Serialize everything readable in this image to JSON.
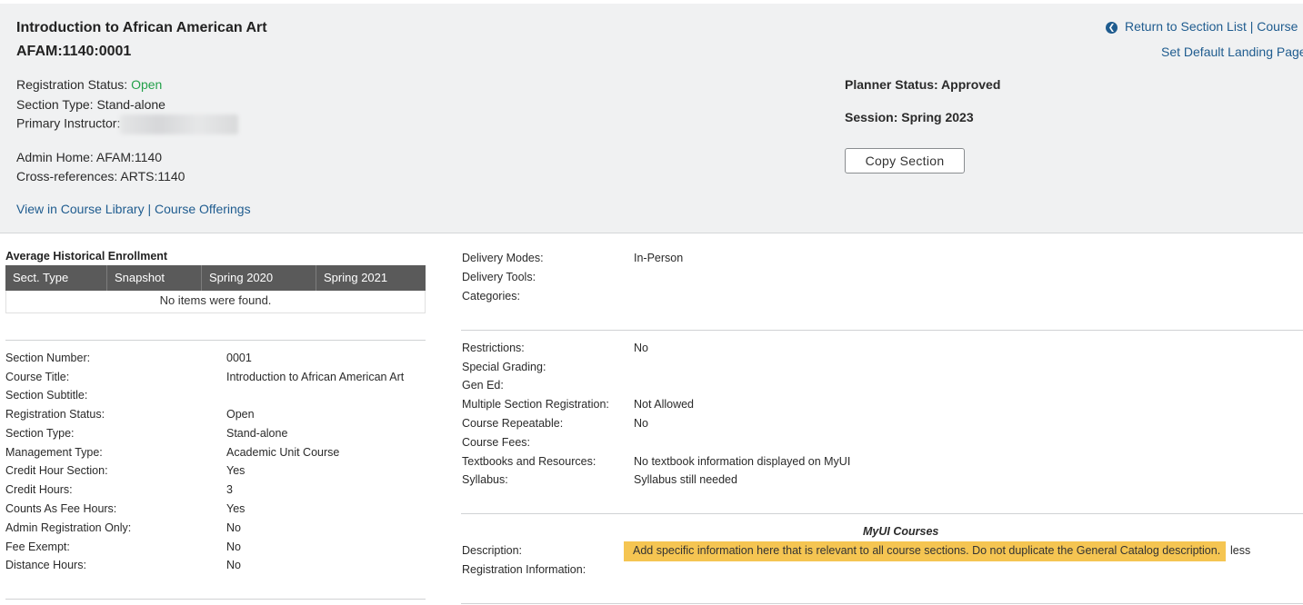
{
  "header": {
    "course_title": "Introduction to African American Art",
    "course_code": "AFAM:1140:0001",
    "registration_status_label": "Registration Status:",
    "registration_status_value": "Open",
    "section_type": "Section Type: Stand-alone",
    "primary_instructor_label": "Primary Instructor:",
    "admin_home": "Admin Home: AFAM:1140",
    "cross_references": "Cross-references: ARTS:1140",
    "view_in_course_library": "View in Course Library",
    "separator": "|",
    "course_offerings": "Course Offerings",
    "return_to_section_list": "Return to Section List",
    "course_link": "Course",
    "set_default_landing_page": "Set Default Landing Page",
    "planner_status": "Planner Status: Approved",
    "session": "Session: Spring 2023",
    "copy_section": "Copy Section"
  },
  "enrollment": {
    "title": "Average Historical Enrollment",
    "columns": [
      "Sect. Type",
      "Snapshot",
      "Spring 2020",
      "Spring 2021"
    ],
    "empty_message": "No items were found."
  },
  "section_details": [
    {
      "label": "Section Number:",
      "value": "0001",
      "label_link": false,
      "value_color": "normal"
    },
    {
      "label": "Course Title:",
      "value": "Introduction to African American Art",
      "label_link": false,
      "value_color": "normal"
    },
    {
      "label": "Section Subtitle:",
      "value": "",
      "label_link": true,
      "value_color": "normal"
    },
    {
      "label": "Registration Status:",
      "value": "Open",
      "label_link": true,
      "value_color": "green"
    },
    {
      "label": "Section Type:",
      "value": "Stand-alone",
      "label_link": false,
      "value_color": "normal"
    },
    {
      "label": "Management Type:",
      "value": "Academic Unit Course",
      "label_link": false,
      "value_color": "normal"
    },
    {
      "label": "Credit Hour Section:",
      "value": "Yes",
      "label_link": false,
      "value_color": "normal"
    },
    {
      "label": "Credit Hours:",
      "value": "3",
      "label_link": true,
      "value_color": "normal"
    },
    {
      "label": "Counts As Fee Hours:",
      "value": "Yes",
      "label_link": false,
      "value_color": "normal"
    },
    {
      "label": "Admin Registration Only:",
      "value": "No",
      "label_link": false,
      "value_color": "normal"
    },
    {
      "label": "Fee Exempt:",
      "value": "No",
      "label_link": false,
      "value_color": "normal"
    },
    {
      "label": "Distance Hours:",
      "value": "No",
      "label_link": false,
      "value_color": "normal"
    }
  ],
  "delivery": [
    {
      "label": "Delivery Modes:",
      "value": "In-Person",
      "label_link": false
    },
    {
      "label": "Delivery Tools:",
      "value": "",
      "label_link": true
    },
    {
      "label": "Categories:",
      "value": "",
      "label_link": true
    }
  ],
  "restrictions": [
    {
      "label": "Restrictions:",
      "value": "No",
      "label_link": true
    },
    {
      "label": "Special Grading:",
      "value": "",
      "label_link": false
    },
    {
      "label": "Gen Ed:",
      "value": "",
      "label_link": false
    },
    {
      "label": "Multiple Section Registration:",
      "value": "Not Allowed",
      "label_link": false
    },
    {
      "label": "Course Repeatable:",
      "value": "No",
      "label_link": false
    },
    {
      "label": "Course Fees:",
      "value": "",
      "label_link": false
    },
    {
      "label": "Textbooks and Resources:",
      "value": "No textbook information displayed on MyUI",
      "label_link": true
    },
    {
      "label": "Syllabus:",
      "value": "Syllabus still needed",
      "label_link": true
    }
  ],
  "myui": {
    "heading": "MyUI Courses",
    "description_label": "Description:",
    "description_text": "Add specific information here that is relevant to all course sections. Do not duplicate the General Catalog description.",
    "less_link": "less",
    "registration_info_label": "Registration Information:"
  },
  "colors": {
    "link": "#1f5c8f",
    "open_green": "#23a04a",
    "header_bg": "#f0f1f2",
    "table_header_bg": "#5a5a5a",
    "highlight": "#f5c552"
  }
}
